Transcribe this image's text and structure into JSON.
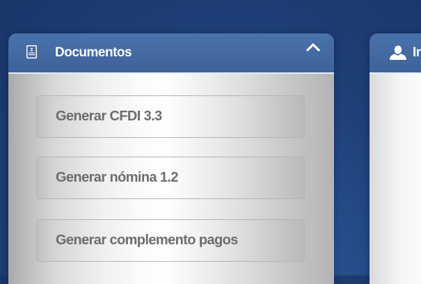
{
  "documents_panel": {
    "title": "Documentos",
    "icon": "document-icon",
    "toggle_icon": "chevron-up-icon",
    "buttons": [
      {
        "label": "Generar CFDI 3.3"
      },
      {
        "label": "Generar nómina 1.2"
      },
      {
        "label": "Generar complemento pagos"
      }
    ]
  },
  "info_panel": {
    "title": "In",
    "icon": "user-icon"
  },
  "colors": {
    "header_blue": "#3d6299",
    "background_blue": "#1e3f77",
    "button_text": "#6d6d6d",
    "button_border": "#b2b2b2"
  }
}
